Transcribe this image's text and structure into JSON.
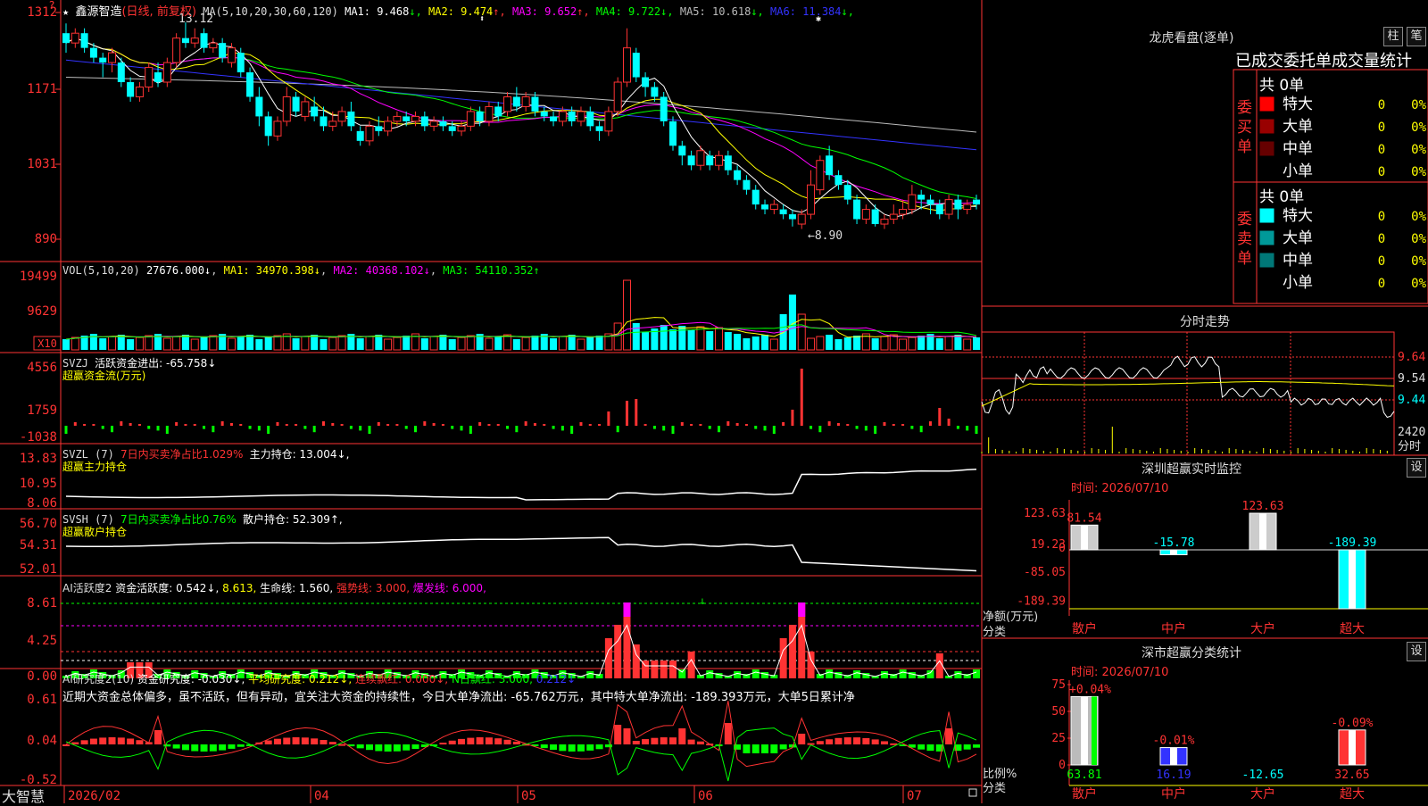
{
  "stock": {
    "name": "鑫源智造",
    "period": "(日线, 前复权)",
    "ma_title": "MA(5,10,20,30,60,120)",
    "ma": [
      {
        "label": "MA1: 9.468",
        "arrow": "↓",
        "color": "#ffffff"
      },
      {
        "label": "MA2: 9.474",
        "arrow": "↑",
        "color": "#ffff00"
      },
      {
        "label": "MA3: 9.652",
        "arrow": "↑",
        "color": "#ff00ff"
      },
      {
        "label": "MA4: 9.722",
        "arrow": "↓",
        "color": "#00ff00"
      },
      {
        "label": "MA5: 10.618",
        "arrow": "↓",
        "color": "#bbbbbb"
      },
      {
        "label": "MA6: 11.384",
        "arrow": "↓",
        "color": "#3333ff"
      }
    ],
    "high_label": "13.12",
    "low_label": "←8.90",
    "price_axis": [
      "1312",
      "1171",
      "1031",
      "890"
    ],
    "candles": [
      {
        "o": 12.9,
        "c": 12.7,
        "h": 13.1,
        "l": 12.5
      },
      {
        "o": 12.7,
        "c": 12.9,
        "h": 13.0,
        "l": 12.6
      },
      {
        "o": 12.9,
        "c": 12.6,
        "h": 13.0,
        "l": 12.5
      },
      {
        "o": 12.6,
        "c": 12.4,
        "h": 12.7,
        "l": 12.3
      },
      {
        "o": 12.4,
        "c": 12.3,
        "h": 12.5,
        "l": 12.0
      },
      {
        "o": 12.3,
        "c": 12.5,
        "h": 12.6,
        "l": 12.1
      },
      {
        "o": 12.3,
        "c": 11.9,
        "h": 12.4,
        "l": 11.8
      },
      {
        "o": 11.9,
        "c": 11.6,
        "h": 12.0,
        "l": 11.5
      },
      {
        "o": 11.6,
        "c": 11.8,
        "h": 11.9,
        "l": 11.5
      },
      {
        "o": 11.8,
        "c": 12.2,
        "h": 12.3,
        "l": 11.7
      },
      {
        "o": 12.1,
        "c": 11.9,
        "h": 12.3,
        "l": 11.8
      },
      {
        "o": 11.9,
        "c": 12.3,
        "h": 12.4,
        "l": 11.8
      },
      {
        "o": 12.3,
        "c": 12.8,
        "h": 12.9,
        "l": 12.2
      },
      {
        "o": 12.8,
        "c": 12.7,
        "h": 13.12,
        "l": 12.6
      },
      {
        "o": 12.7,
        "c": 12.8,
        "h": 13.0,
        "l": 12.6
      },
      {
        "o": 12.9,
        "c": 12.6,
        "h": 13.0,
        "l": 12.5
      },
      {
        "o": 12.6,
        "c": 12.7,
        "h": 12.8,
        "l": 12.5
      },
      {
        "o": 12.7,
        "c": 12.4,
        "h": 12.8,
        "l": 12.3
      },
      {
        "o": 12.3,
        "c": 12.6,
        "h": 12.7,
        "l": 12.2
      },
      {
        "o": 12.5,
        "c": 12.1,
        "h": 12.6,
        "l": 12.0
      },
      {
        "o": 12.1,
        "c": 11.6,
        "h": 12.2,
        "l": 11.5
      },
      {
        "o": 11.6,
        "c": 11.2,
        "h": 11.8,
        "l": 11.0
      },
      {
        "o": 11.2,
        "c": 10.8,
        "h": 11.3,
        "l": 10.6
      },
      {
        "o": 10.8,
        "c": 11.1,
        "h": 11.2,
        "l": 10.7
      },
      {
        "o": 11.1,
        "c": 11.6,
        "h": 11.8,
        "l": 11.0
      },
      {
        "o": 11.6,
        "c": 11.3,
        "h": 11.7,
        "l": 11.2
      },
      {
        "o": 11.2,
        "c": 11.5,
        "h": 11.6,
        "l": 11.1
      },
      {
        "o": 11.4,
        "c": 11.2,
        "h": 11.6,
        "l": 11.1
      },
      {
        "o": 11.2,
        "c": 11.0,
        "h": 11.4,
        "l": 10.9
      },
      {
        "o": 11.0,
        "c": 11.1,
        "h": 11.3,
        "l": 10.9
      },
      {
        "o": 11.1,
        "c": 11.3,
        "h": 11.4,
        "l": 11.0
      },
      {
        "o": 11.3,
        "c": 11.0,
        "h": 11.5,
        "l": 10.9
      },
      {
        "o": 10.9,
        "c": 10.7,
        "h": 11.0,
        "l": 10.6
      },
      {
        "o": 10.7,
        "c": 11.0,
        "h": 11.1,
        "l": 10.6
      },
      {
        "o": 11.0,
        "c": 10.9,
        "h": 11.2,
        "l": 10.8
      },
      {
        "o": 10.9,
        "c": 11.1,
        "h": 11.2,
        "l": 10.8
      },
      {
        "o": 11.1,
        "c": 11.2,
        "h": 11.3,
        "l": 11.0
      },
      {
        "o": 11.2,
        "c": 11.1,
        "h": 11.3,
        "l": 11.0
      },
      {
        "o": 11.1,
        "c": 11.2,
        "h": 11.3,
        "l": 11.0
      },
      {
        "o": 11.2,
        "c": 11.0,
        "h": 11.3,
        "l": 10.9
      },
      {
        "o": 11.0,
        "c": 11.1,
        "h": 11.2,
        "l": 10.9
      },
      {
        "o": 11.1,
        "c": 11.0,
        "h": 11.2,
        "l": 10.9
      },
      {
        "o": 11.0,
        "c": 10.9,
        "h": 11.1,
        "l": 10.8
      },
      {
        "o": 10.9,
        "c": 11.0,
        "h": 11.1,
        "l": 10.8
      },
      {
        "o": 11.0,
        "c": 11.3,
        "h": 11.4,
        "l": 10.9
      },
      {
        "o": 11.3,
        "c": 11.1,
        "h": 11.4,
        "l": 11.0
      },
      {
        "o": 11.1,
        "c": 11.4,
        "h": 11.5,
        "l": 11.0
      },
      {
        "o": 11.4,
        "c": 11.2,
        "h": 11.5,
        "l": 11.1
      },
      {
        "o": 11.3,
        "c": 11.6,
        "h": 11.7,
        "l": 11.2
      },
      {
        "o": 11.6,
        "c": 11.4,
        "h": 11.8,
        "l": 11.3
      },
      {
        "o": 11.4,
        "c": 11.6,
        "h": 11.7,
        "l": 11.3
      },
      {
        "o": 11.6,
        "c": 11.3,
        "h": 11.7,
        "l": 11.2
      },
      {
        "o": 11.3,
        "c": 11.2,
        "h": 11.4,
        "l": 11.1
      },
      {
        "o": 11.2,
        "c": 11.1,
        "h": 11.3,
        "l": 11.0
      },
      {
        "o": 11.1,
        "c": 11.3,
        "h": 11.4,
        "l": 11.0
      },
      {
        "o": 11.3,
        "c": 11.1,
        "h": 11.4,
        "l": 11.0
      },
      {
        "o": 11.1,
        "c": 11.3,
        "h": 11.4,
        "l": 11.0
      },
      {
        "o": 11.3,
        "c": 11.0,
        "h": 11.4,
        "l": 10.9
      },
      {
        "o": 11.0,
        "c": 10.9,
        "h": 11.1,
        "l": 10.7
      },
      {
        "o": 10.9,
        "c": 11.3,
        "h": 11.4,
        "l": 10.8
      },
      {
        "o": 11.3,
        "c": 11.9,
        "h": 12.0,
        "l": 11.2
      },
      {
        "o": 11.9,
        "c": 12.6,
        "h": 13.0,
        "l": 11.8
      },
      {
        "o": 12.5,
        "c": 12.0,
        "h": 12.6,
        "l": 11.9
      },
      {
        "o": 12.0,
        "c": 11.8,
        "h": 12.1,
        "l": 11.6
      },
      {
        "o": 11.8,
        "c": 11.6,
        "h": 11.9,
        "l": 11.5
      },
      {
        "o": 11.6,
        "c": 11.1,
        "h": 11.7,
        "l": 11.0
      },
      {
        "o": 11.1,
        "c": 10.6,
        "h": 11.2,
        "l": 10.5
      },
      {
        "o": 10.6,
        "c": 10.4,
        "h": 10.7,
        "l": 10.2
      },
      {
        "o": 10.4,
        "c": 10.2,
        "h": 10.5,
        "l": 10.1
      },
      {
        "o": 10.2,
        "c": 10.5,
        "h": 10.6,
        "l": 10.1
      },
      {
        "o": 10.4,
        "c": 10.2,
        "h": 10.5,
        "l": 10.1
      },
      {
        "o": 10.2,
        "c": 10.4,
        "h": 10.5,
        "l": 10.1
      },
      {
        "o": 10.4,
        "c": 10.1,
        "h": 10.5,
        "l": 10.0
      },
      {
        "o": 10.1,
        "c": 9.9,
        "h": 10.2,
        "l": 9.8
      },
      {
        "o": 9.9,
        "c": 9.7,
        "h": 10.0,
        "l": 9.6
      },
      {
        "o": 9.7,
        "c": 9.4,
        "h": 9.8,
        "l": 9.3
      },
      {
        "o": 9.4,
        "c": 9.3,
        "h": 9.5,
        "l": 9.2
      },
      {
        "o": 9.3,
        "c": 9.4,
        "h": 9.5,
        "l": 9.2
      },
      {
        "o": 9.3,
        "c": 9.2,
        "h": 9.4,
        "l": 9.1
      },
      {
        "o": 9.2,
        "c": 9.1,
        "h": 9.3,
        "l": 8.95
      },
      {
        "o": 9.0,
        "c": 9.2,
        "h": 9.3,
        "l": 8.9
      },
      {
        "o": 9.2,
        "c": 9.8,
        "h": 10.1,
        "l": 9.1
      },
      {
        "o": 9.7,
        "c": 10.3,
        "h": 10.4,
        "l": 9.6
      },
      {
        "o": 10.4,
        "c": 10.0,
        "h": 10.6,
        "l": 9.9
      },
      {
        "o": 10.0,
        "c": 9.8,
        "h": 10.1,
        "l": 9.7
      },
      {
        "o": 9.8,
        "c": 9.5,
        "h": 9.9,
        "l": 9.4
      },
      {
        "o": 9.5,
        "c": 9.1,
        "h": 9.6,
        "l": 9.0
      },
      {
        "o": 9.1,
        "c": 9.3,
        "h": 9.4,
        "l": 9.0
      },
      {
        "o": 9.3,
        "c": 9.0,
        "h": 9.4,
        "l": 8.95
      },
      {
        "o": 9.0,
        "c": 9.1,
        "h": 9.2,
        "l": 8.9
      },
      {
        "o": 9.1,
        "c": 9.2,
        "h": 9.4,
        "l": 9.0
      },
      {
        "o": 9.2,
        "c": 9.3,
        "h": 9.5,
        "l": 9.1
      },
      {
        "o": 9.3,
        "c": 9.6,
        "h": 9.8,
        "l": 9.2
      },
      {
        "o": 9.6,
        "c": 9.5,
        "h": 9.7,
        "l": 9.3
      },
      {
        "o": 9.5,
        "c": 9.4,
        "h": 9.6,
        "l": 9.2
      },
      {
        "o": 9.4,
        "c": 9.2,
        "h": 9.5,
        "l": 9.1
      },
      {
        "o": 9.2,
        "c": 9.5,
        "h": 9.6,
        "l": 9.1
      },
      {
        "o": 9.5,
        "c": 9.3,
        "h": 9.6,
        "l": 9.1
      },
      {
        "o": 9.3,
        "c": 9.4,
        "h": 9.5,
        "l": 9.2
      },
      {
        "o": 9.5,
        "c": 9.4,
        "h": 9.6,
        "l": 9.3
      }
    ],
    "vol_panel": {
      "header": "VOL(5,10,20)",
      "value": "27676.000↓",
      "ma1": "MA1: 34970.398↓",
      "ma2": "MA2: 40368.102↓",
      "ma3": "MA3: 54110.352↑",
      "axis": [
        "19499",
        "9629"
      ],
      "unit": "X10"
    },
    "svzj_panel": {
      "header": "SVZJ",
      "title": "活跃资金进出: -65.758↓",
      "subtitle": "超赢资金流(万元)",
      "axis": [
        "4556",
        "1759",
        "-1038"
      ]
    },
    "svzl_panel": {
      "header": "SVZL (7)",
      "ratio": "7日内买卖净占比1.029%",
      "hold": "主力持仓: 13.004↓,",
      "subtitle": "超赢主力持仓",
      "axis": [
        "13.83",
        "10.95",
        "8.06"
      ]
    },
    "svsh_panel": {
      "header": "SVSH (7)",
      "ratio": "7日内买卖净占比0.76%",
      "hold": "散户持仓: 52.309↑,",
      "subtitle": "超赢散户持仓",
      "axis": [
        "56.70",
        "54.31",
        "52.01"
      ]
    },
    "ai1_panel": {
      "header": "AI活跃度2",
      "a": "资金活跃度: 0.542↓,",
      "b": "8.613,",
      "c": "生命线: 1.560,",
      "d": "强势线: 3.000,",
      "e": "爆发线: 6.000,",
      "axis": [
        "8.61",
        "4.25",
        "0.00"
      ]
    },
    "ai2_panel": {
      "header": "AI研究度2(10)",
      "a": "资金研究度: -0.030↓,",
      "b": "平均研究度: 0.212↓,",
      "c": "连续飘红: 0.000↓,",
      "d": "N日飘红: 3.000,",
      "e": "0.212↓",
      "note": "近期大资金总体偏多，虽不活跃，但有异动，宜关注大资金的持续性，今日大单净流出: -65.762万元，其中特大单净流出: -189.393万元，大单5日累计净",
      "axis": [
        "0.61",
        "0.04",
        "-0.52"
      ]
    },
    "bottom_bar": {
      "brand": "大智慧",
      "dates": [
        "2026/02",
        "04",
        "05",
        "06",
        "07"
      ]
    }
  },
  "right_panel": {
    "lhb_title": "龙虎看盘(逐单)",
    "btn_bar": "柱",
    "btn_pen": "笔",
    "stats_title": "已成交委托单成交量统计",
    "buy_label": "委买单",
    "sell_label": "委卖单",
    "buy_total": "共 0单",
    "sell_total": "共 0单",
    "buy_rows": [
      {
        "name": "特大",
        "count": "0",
        "pct": "0%",
        "color": "#ff0000"
      },
      {
        "name": "大单",
        "count": "0",
        "pct": "0%",
        "color": "#990000"
      },
      {
        "name": "中单",
        "count": "0",
        "pct": "0%",
        "color": "#660000"
      },
      {
        "name": "小单",
        "count": "0",
        "pct": "0%",
        "color": "#000000"
      }
    ],
    "sell_rows": [
      {
        "name": "特大",
        "count": "0",
        "pct": "0%",
        "color": "#00ffff"
      },
      {
        "name": "大单",
        "count": "0",
        "pct": "0%",
        "color": "#009999"
      },
      {
        "name": "中单",
        "count": "0",
        "pct": "0%",
        "color": "#007777"
      },
      {
        "name": "小单",
        "count": "0",
        "pct": "0%",
        "color": "#000000"
      }
    ],
    "intraday_title": "分时走势",
    "intraday_axis": [
      "9.64",
      "9.54",
      "9.44"
    ],
    "intraday_vol": "2420",
    "intraday_vol_unit": "分时",
    "sz_monitor_title": "深圳超赢实时监控",
    "sz_set": "设",
    "sz_time": "时间: 2026/07/10",
    "sz_axis": [
      "123.63",
      "19.23",
      "0",
      "-85.05",
      "-189.39"
    ],
    "sz_unit_a": "净额(万元)",
    "sz_unit_b": "分类",
    "sz_bars": [
      {
        "name": "散户",
        "value": 81.54,
        "label": "81.54",
        "color": "#ff3333"
      },
      {
        "name": "中户",
        "value": -15.78,
        "label": "-15.78",
        "color": "#00ffff"
      },
      {
        "name": "大户",
        "value": 123.63,
        "label": "123.63",
        "color": "#ff3333"
      },
      {
        "name": "超大",
        "value": -189.39,
        "label": "-189.39",
        "color": "#00ffff"
      }
    ],
    "cls_title": "深市超赢分类统计",
    "cls_set": "设",
    "cls_time": "时间: 2026/07/10",
    "cls_axis": [
      "75",
      "50",
      "25",
      "0"
    ],
    "cls_unit_a": "比例%",
    "cls_unit_b": "分类",
    "cls_bars": [
      {
        "name": "散户",
        "value": 63.81,
        "label": "63.81",
        "delta": "+0.04%",
        "bar": "#bbbbbb",
        "val_color": "#00ff00"
      },
      {
        "name": "中户",
        "value": 16.19,
        "label": "16.19",
        "delta": "-0.01%",
        "bar": "#3333ff",
        "val_color": "#3333ff"
      },
      {
        "name": "大户",
        "value": -12.65,
        "label": "-12.65",
        "delta": "",
        "bar": "#00ffff",
        "val_color": "#00ffff"
      },
      {
        "name": "超大",
        "value": 32.65,
        "label": "32.65",
        "delta": "-0.09%",
        "bar": "#ff3333",
        "val_color": "#ff3333"
      }
    ]
  }
}
